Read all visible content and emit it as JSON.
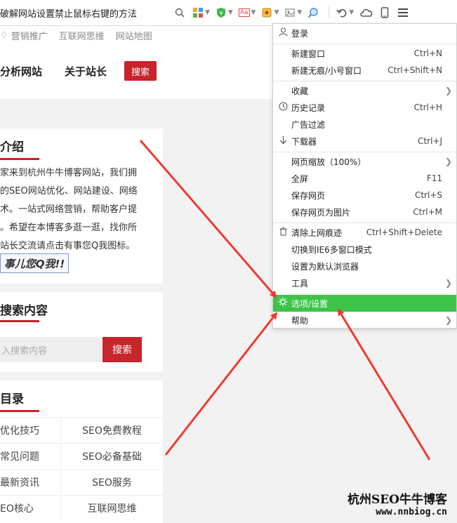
{
  "toolbar": {
    "address_text": "破解网站设置禁止鼠标右键的方法",
    "icons": [
      "search-icon",
      "apps-icon",
      "shield-icon",
      "translate-icon",
      "extension-icon",
      "screenshot-icon",
      "zoom-icon",
      "undo-icon",
      "cloud-icon",
      "phone-icon",
      "menu-icon"
    ],
    "translate_label": "Aa"
  },
  "bookmarks": [
    "营销推广",
    "互联网思维",
    "网站地图"
  ],
  "nav": {
    "links": [
      "分析网站",
      "关于站长"
    ],
    "search_label": "搜索"
  },
  "intro": {
    "title": "介绍",
    "lines": [
      "家来到杭州牛牛博客网站，我们拥",
      "的SEO网站优化、网站建设、网络",
      "术。一站式网络营销，帮助客户提",
      "。希望在本博客多逛一逛，找你所",
      "站长交流请点击有事您Q我图标。"
    ],
    "qq_button": "事儿您Q我!!"
  },
  "search_card": {
    "title": "搜索内容",
    "placeholder": "入搜索内容",
    "button": "搜索"
  },
  "catalog": {
    "title": "目录",
    "cells": [
      [
        "优化技巧",
        "SEO免费教程"
      ],
      [
        "常见问题",
        "SEO必备基础"
      ],
      [
        "最新资讯",
        "SEO服务"
      ],
      [
        "EO核心",
        "互联网思维"
      ]
    ]
  },
  "menu": {
    "items": [
      {
        "label": "登录",
        "shortcut": "",
        "icon": "user-icon"
      },
      {
        "label": "新建窗口",
        "shortcut": "Ctrl+N"
      },
      {
        "label": "新建无痕/小号窗口",
        "shortcut": "Ctrl+Shift+N"
      },
      {
        "label": "收藏",
        "shortcut": "",
        "submenu": true
      },
      {
        "label": "历史记录",
        "shortcut": "Ctrl+H",
        "icon": "clock-icon"
      },
      {
        "label": "广告过滤",
        "shortcut": ""
      },
      {
        "label": "下载器",
        "shortcut": "Ctrl+J",
        "icon": "download-icon"
      },
      {
        "label": "网页缩放（100%）",
        "shortcut": "",
        "submenu": true
      },
      {
        "label": "全屏",
        "shortcut": "F11"
      },
      {
        "label": "保存网页",
        "shortcut": "Ctrl+S"
      },
      {
        "label": "保存网页为图片",
        "shortcut": "Ctrl+M"
      },
      {
        "label": "清除上网痕迹",
        "shortcut": "Ctrl+Shift+Delete",
        "icon": "trash-icon"
      },
      {
        "label": "切换到IE6多窗口模式",
        "shortcut": ""
      },
      {
        "label": "设置为默认浏览器",
        "shortcut": ""
      },
      {
        "label": "工具",
        "shortcut": "",
        "submenu": true
      },
      {
        "label": "选项/设置",
        "shortcut": "",
        "icon": "gear-icon",
        "highlighted": true
      },
      {
        "label": "帮助",
        "shortcut": "",
        "submenu": true
      }
    ],
    "highlight_color": "#3ec34a"
  },
  "watermark": {
    "line1": "杭州SEO牛牛博客",
    "line2": "www.nnbiog.cn"
  },
  "colors": {
    "accent_red": "#c7242b",
    "arrow_red": "#f03a2e"
  }
}
